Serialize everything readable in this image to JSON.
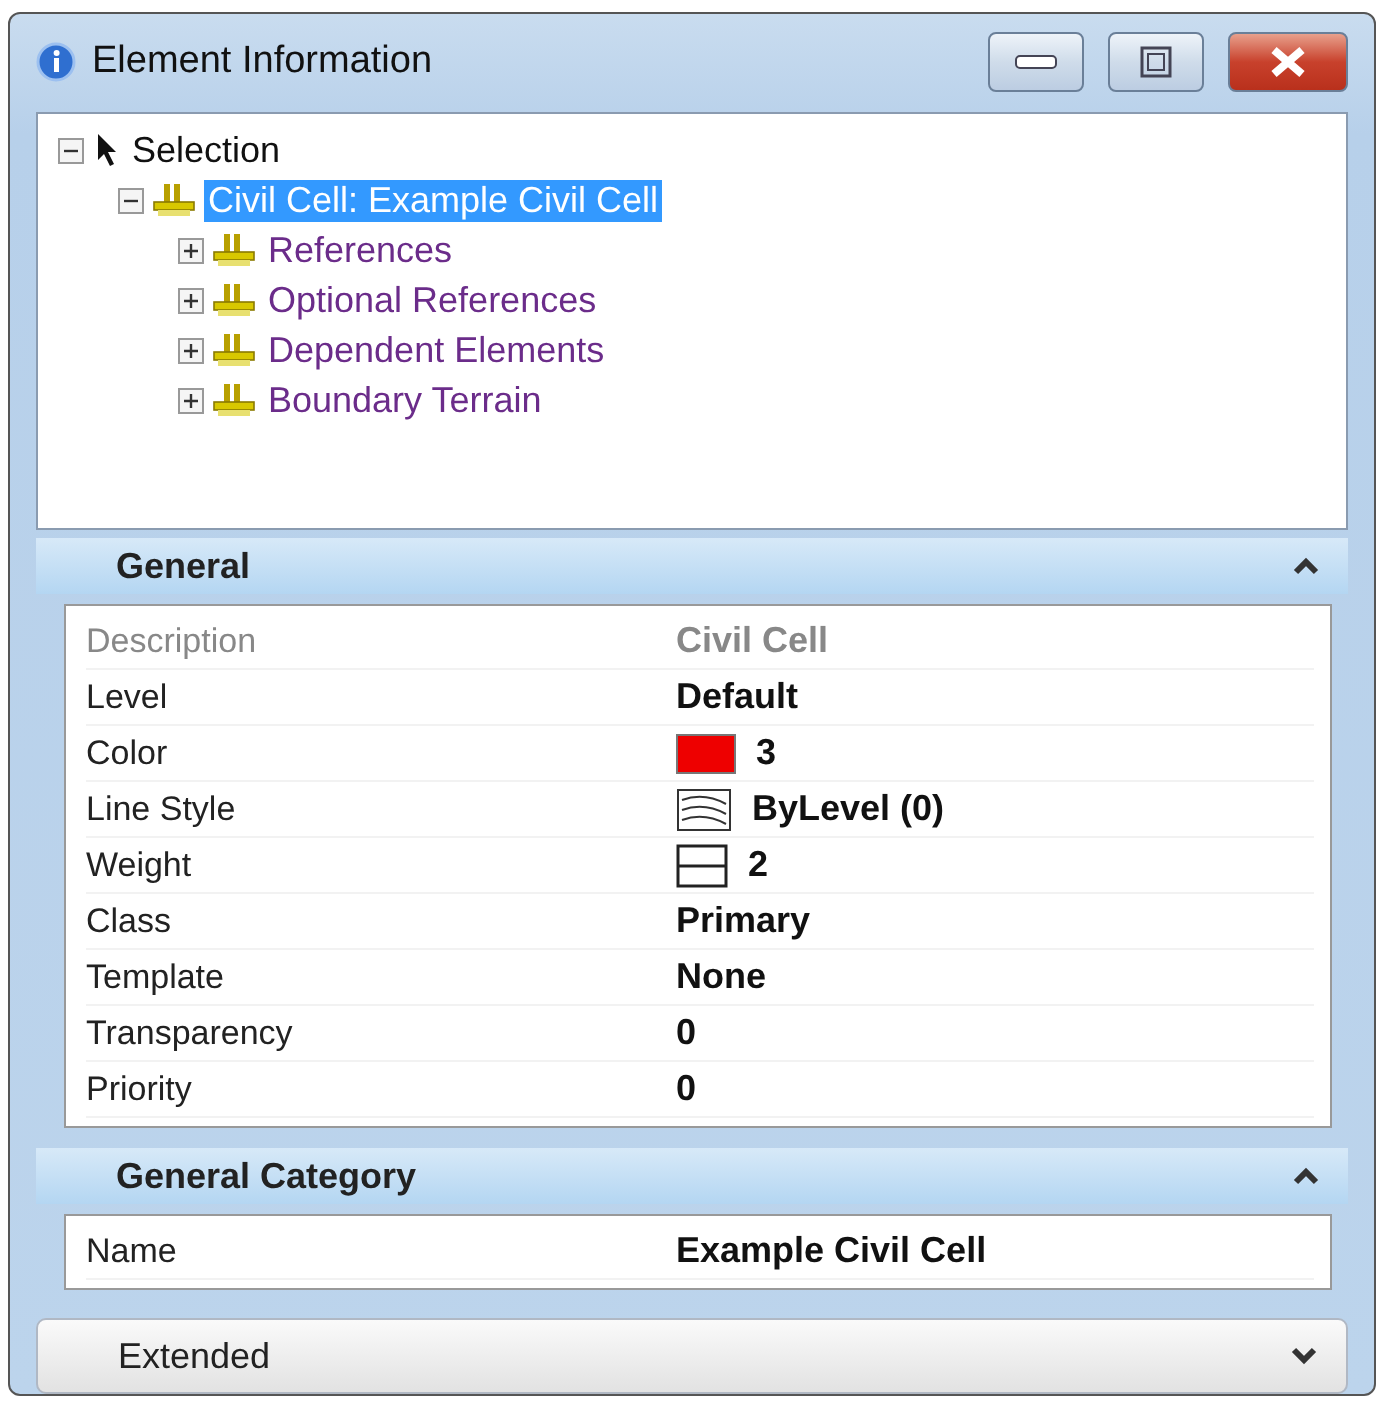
{
  "window": {
    "title": "Element Information"
  },
  "tree": [
    {
      "label": "Selection",
      "selected": false,
      "expanded": true,
      "children": [
        {
          "label": "Civil Cell: Example Civil Cell",
          "selected": true,
          "expanded": true,
          "children": [
            {
              "label": "References",
              "selected": false,
              "expanded": false
            },
            {
              "label": "Optional References",
              "selected": false,
              "expanded": false
            },
            {
              "label": "Dependent Elements",
              "selected": false,
              "expanded": false
            },
            {
              "label": "Boundary Terrain",
              "selected": false,
              "expanded": false
            }
          ]
        }
      ]
    }
  ],
  "sections": [
    {
      "title": "General",
      "expanded": true,
      "rows": [
        {
          "name": "Description",
          "value": "Civil Cell",
          "kind": "text",
          "disabled": true
        },
        {
          "name": "Level",
          "value": "Default",
          "kind": "text",
          "disabled": false
        },
        {
          "name": "Color",
          "value": "3",
          "kind": "color",
          "color": "#ee0000",
          "disabled": false
        },
        {
          "name": "Line Style",
          "value": "ByLevel (0)",
          "kind": "linestyle",
          "disabled": false
        },
        {
          "name": "Weight",
          "value": "2",
          "kind": "weight",
          "disabled": false
        },
        {
          "name": "Class",
          "value": "Primary",
          "kind": "text",
          "disabled": false
        },
        {
          "name": "Template",
          "value": "None",
          "kind": "text",
          "disabled": false
        },
        {
          "name": "Transparency",
          "value": "0",
          "kind": "text",
          "disabled": false
        },
        {
          "name": "Priority",
          "value": "0",
          "kind": "text",
          "disabled": false
        }
      ]
    },
    {
      "title": "General Category",
      "expanded": true,
      "rows": [
        {
          "name": "Name",
          "value": "Example Civil Cell",
          "kind": "text",
          "disabled": false
        }
      ]
    },
    {
      "title": "Extended",
      "expanded": false
    }
  ]
}
